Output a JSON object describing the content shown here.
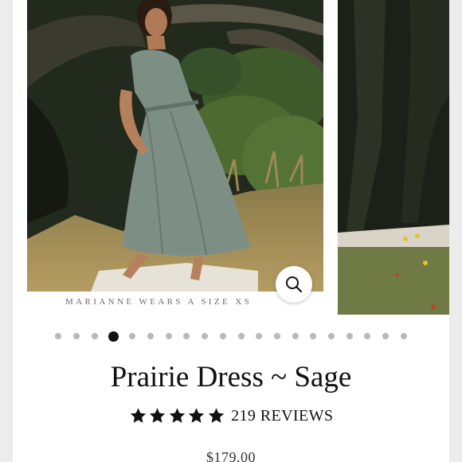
{
  "gallery": {
    "caption": "MARIANNE WEARS A SIZE XS",
    "slide_count": 20,
    "active_index": 3,
    "zoom_icon": "search-icon"
  },
  "product": {
    "title": "Prairie Dress ~ Sage",
    "rating": 5,
    "reviews_label": "219 REVIEWS",
    "price": "$179.00"
  },
  "colors": {
    "active_dot": "#111111",
    "inactive_dot": "#b9b9b9",
    "star": "#111111"
  }
}
